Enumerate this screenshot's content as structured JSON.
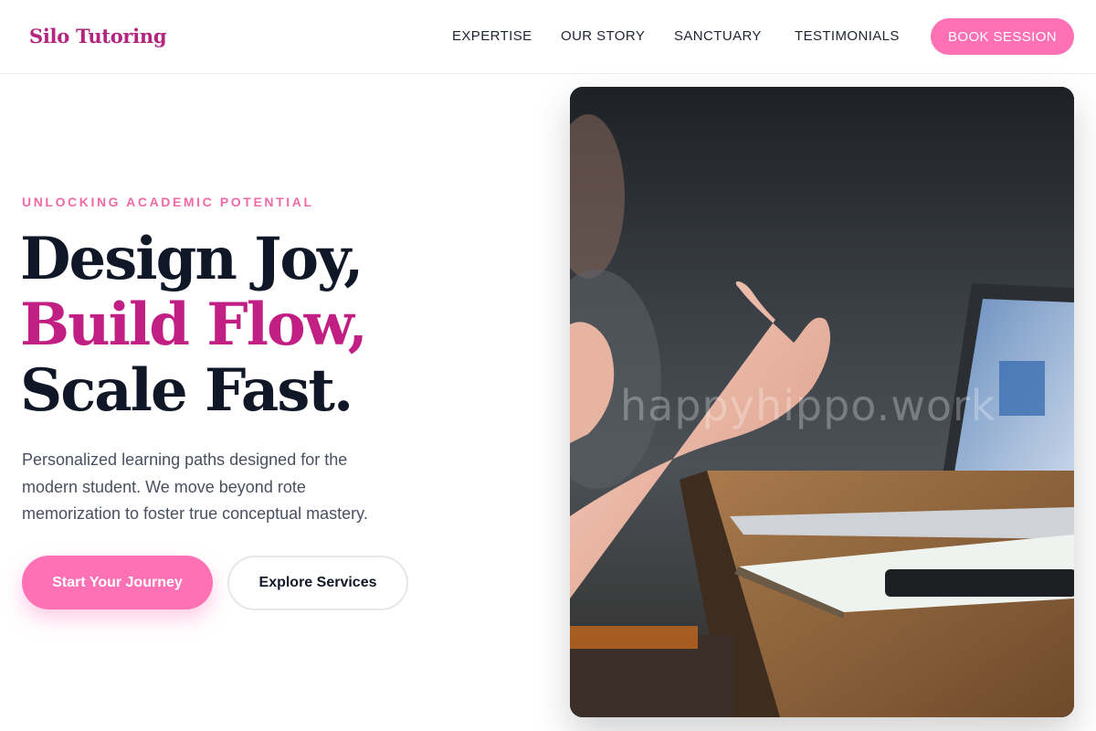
{
  "brand": {
    "name": "Silo Tutoring",
    "color": "#b3247e"
  },
  "nav": {
    "links": [
      "EXPERTISE",
      "OUR STORY",
      "SANCTUARY",
      "TESTIMONIALS"
    ],
    "cta": "BOOK SESSION"
  },
  "hero": {
    "eyebrow": "UNLOCKING ACADEMIC POTENTIAL",
    "headline": [
      "Design Joy,",
      "Build Flow,",
      "Scale Fast."
    ],
    "subtext": "Personalized learning paths designed for the modern student. We move beyond rote memorization to foster true conceptual mastery.",
    "primary_button": "Start Your Journey",
    "secondary_button": "Explore Services"
  },
  "image": {
    "watermark": "happyhippo.work",
    "subject": "hands gesturing over a wooden table with laptops, notebook and phone"
  },
  "colors": {
    "accent_pink": "#ff71b5",
    "headline_accent": "#c11f84",
    "eyebrow": "#f06aa8",
    "text_dark": "#101828"
  }
}
